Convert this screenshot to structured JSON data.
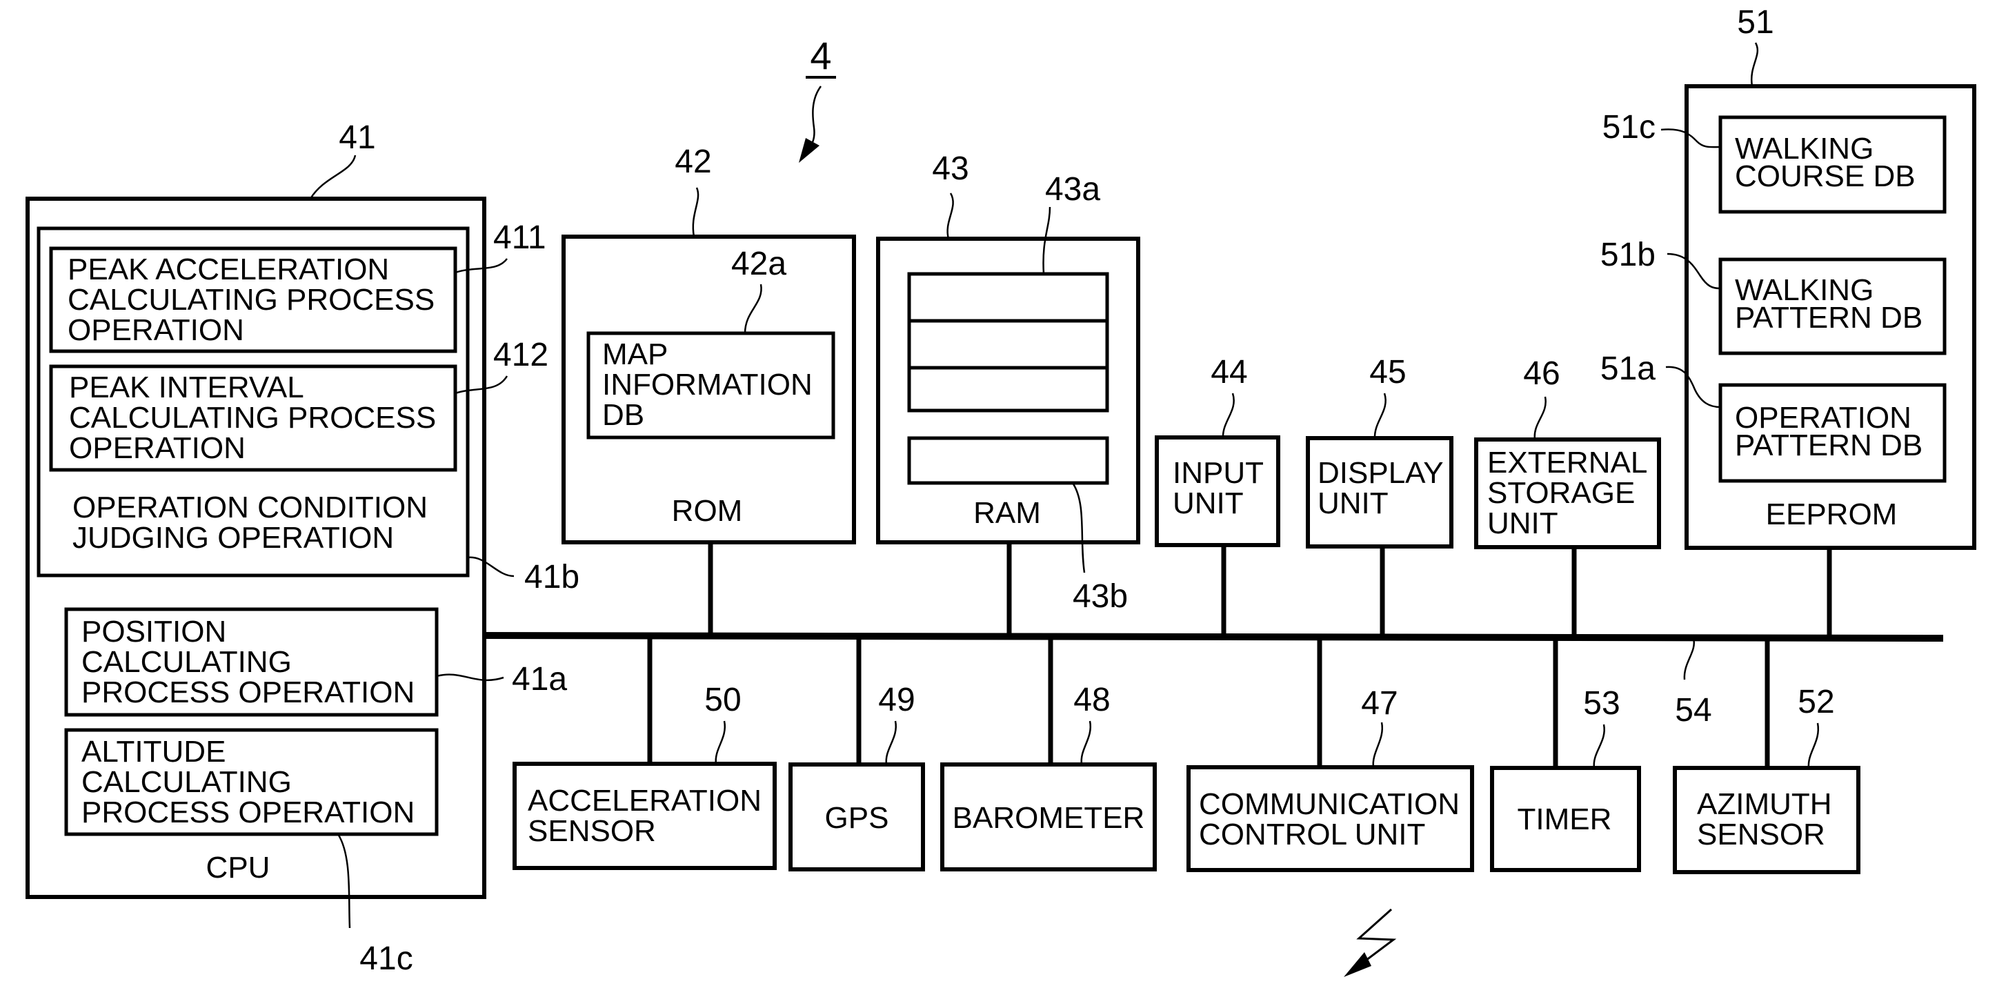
{
  "figure": {
    "ref": "4",
    "bus_ref": "54",
    "wireless_icon": "lightning-arrow-icon"
  },
  "cpu": {
    "ref": "41",
    "label": "CPU",
    "judging_block": {
      "ref": "41b",
      "text": [
        "OPERATION CONDITION",
        "JUDGING OPERATION"
      ],
      "peak_accel": {
        "ref": "411",
        "text": [
          "PEAK ACCELERATION",
          "CALCULATING PROCESS",
          "OPERATION"
        ]
      },
      "peak_interval": {
        "ref": "412",
        "text": [
          "PEAK INTERVAL",
          "CALCULATING PROCESS",
          "OPERATION"
        ]
      }
    },
    "position": {
      "ref": "41a",
      "text": [
        "POSITION",
        "CALCULATING",
        "PROCESS OPERATION"
      ]
    },
    "altitude": {
      "ref": "41c",
      "text": [
        "ALTITUDE",
        "CALCULATING",
        "PROCESS OPERATION"
      ]
    }
  },
  "rom": {
    "ref": "42",
    "label": "ROM",
    "map_db": {
      "ref": "42a",
      "text": [
        "MAP",
        "INFORMATION",
        "DB"
      ]
    }
  },
  "ram": {
    "ref": "43",
    "label": "RAM",
    "area_a_ref": "43a",
    "area_b_ref": "43b"
  },
  "upper_units": [
    {
      "ref": "44",
      "text": [
        "INPUT",
        "UNIT"
      ]
    },
    {
      "ref": "45",
      "text": [
        "DISPLAY",
        "UNIT"
      ]
    },
    {
      "ref": "46",
      "text": [
        "EXTERNAL",
        "STORAGE",
        "UNIT"
      ]
    }
  ],
  "eeprom": {
    "ref": "51",
    "label": "EEPROM",
    "dbs": [
      {
        "ref": "51c",
        "text": [
          "WALKING",
          "COURSE DB"
        ]
      },
      {
        "ref": "51b",
        "text": [
          "WALKING",
          "PATTERN DB"
        ]
      },
      {
        "ref": "51a",
        "text": [
          "OPERATION",
          "PATTERN DB"
        ]
      }
    ]
  },
  "lower_units": [
    {
      "ref": "50",
      "text": [
        "ACCELERATION",
        "SENSOR"
      ]
    },
    {
      "ref": "49",
      "text": [
        "GPS"
      ]
    },
    {
      "ref": "48",
      "text": [
        "BAROMETER"
      ]
    },
    {
      "ref": "47",
      "text": [
        "COMMUNICATION",
        "CONTROL UNIT"
      ]
    },
    {
      "ref": "53",
      "text": [
        "TIMER"
      ]
    },
    {
      "ref": "52",
      "text": [
        "AZIMUTH",
        "SENSOR"
      ]
    }
  ]
}
